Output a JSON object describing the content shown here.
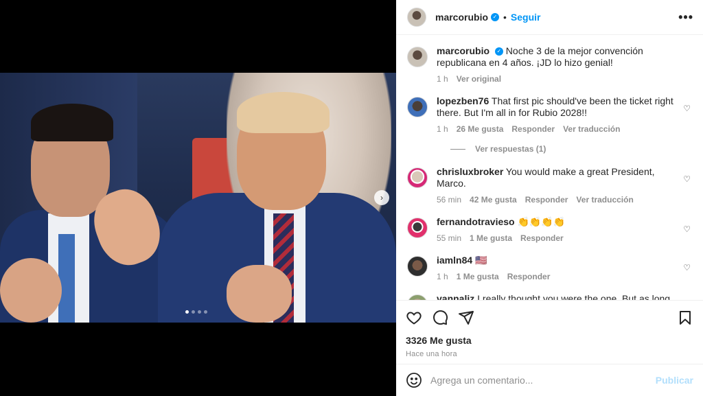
{
  "post": {
    "username": "marcorubio",
    "follow_label": "Seguir",
    "separator": "•",
    "more_label": "•••",
    "next_label": "›"
  },
  "caption": {
    "username": "marcorubio",
    "text": "Noche 3 de la mejor convención republicana en 4 años. ¡JD lo hizo genial!",
    "time": "1 h",
    "see_original": "Ver original"
  },
  "comments": [
    {
      "username": "lopezben76",
      "text": "That first pic should've been the ticket right there. But I'm all in for Rubio 2028!!",
      "time": "1 h",
      "likes": "26 Me gusta",
      "reply": "Responder",
      "translate": "Ver traducción"
    },
    {
      "username": "chrisluxbroker",
      "text": "You would make a great President, Marco.",
      "time": "56 min",
      "likes": "42 Me gusta",
      "reply": "Responder",
      "translate": "Ver traducción"
    },
    {
      "username": "fernandotravieso",
      "text": "👏👏👏👏",
      "time": "55 min",
      "likes": "1 Me gusta",
      "reply": "Responder"
    },
    {
      "username": "iamln84",
      "text": "🇺🇸",
      "time": "1 h",
      "likes": "1 Me gusta",
      "reply": "Responder"
    },
    {
      "username": "vannaliz",
      "text": "I really thought you were the one. But as long as"
    }
  ],
  "replies_label": "Ver respuestas (1)",
  "likes_total": "3326 Me gusta",
  "posted_ago": "Hace una hora",
  "composer": {
    "placeholder": "Agrega un comentario...",
    "publish_label": "Publicar"
  },
  "carousel": {
    "count": 4,
    "active": 1
  },
  "colors": {
    "accent": "#0095f6",
    "muted": "#8e8e8e",
    "publish_disabled": "#b2dffc"
  }
}
